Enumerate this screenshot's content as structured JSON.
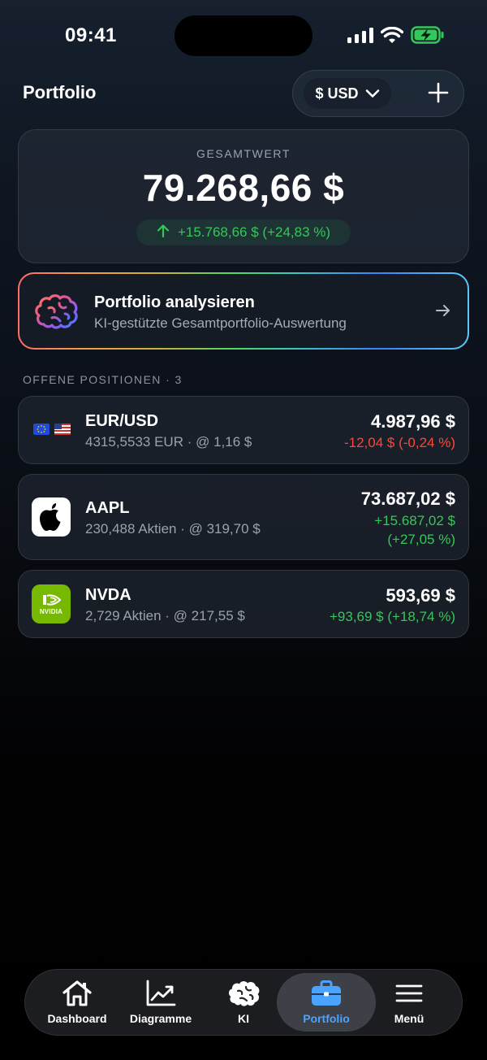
{
  "status_bar": {
    "time": "09:41"
  },
  "header": {
    "title": "Portfolio",
    "currency_label": "$ USD"
  },
  "summary": {
    "label": "GESAMTWERT",
    "value": "79.268,66 $",
    "change": "+15.768,66 $ (+24,83 %)"
  },
  "analyze": {
    "title": "Portfolio analysieren",
    "subtitle": "KI-gestützte Gesamtportfolio-Auswertung"
  },
  "positions_header": "OFFENE POSITIONEN · 3",
  "positions": [
    {
      "symbol": "EUR/USD",
      "detail": "4315,5533 EUR · @ 1,16 $",
      "value": "4.987,96 $",
      "change": "-12,04 $ (-0,24 %)",
      "trend": "down"
    },
    {
      "symbol": "AAPL",
      "detail": "230,488 Aktien · @ 319,70 $",
      "value": "73.687,02 $",
      "change_line1": "+15.687,02 $",
      "change_line2": "(+27,05 %)",
      "trend": "up"
    },
    {
      "symbol": "NVDA",
      "detail": "2,729 Aktien · @ 217,55 $",
      "value": "593,69 $",
      "change": "+93,69 $ (+18,74 %)",
      "trend": "up",
      "logo_text": "NVIDIA"
    }
  ],
  "tabs": [
    {
      "label": "Dashboard",
      "icon": "home-icon"
    },
    {
      "label": "Diagramme",
      "icon": "chart-icon"
    },
    {
      "label": "KI",
      "icon": "brain-icon"
    },
    {
      "label": "Portfolio",
      "icon": "briefcase-icon",
      "active": true
    },
    {
      "label": "Menü",
      "icon": "menu-icon"
    }
  ],
  "colors": {
    "positive": "#34c759",
    "negative": "#ff453a",
    "accent": "#4aa3ff",
    "nvidia_green": "#76b900"
  }
}
